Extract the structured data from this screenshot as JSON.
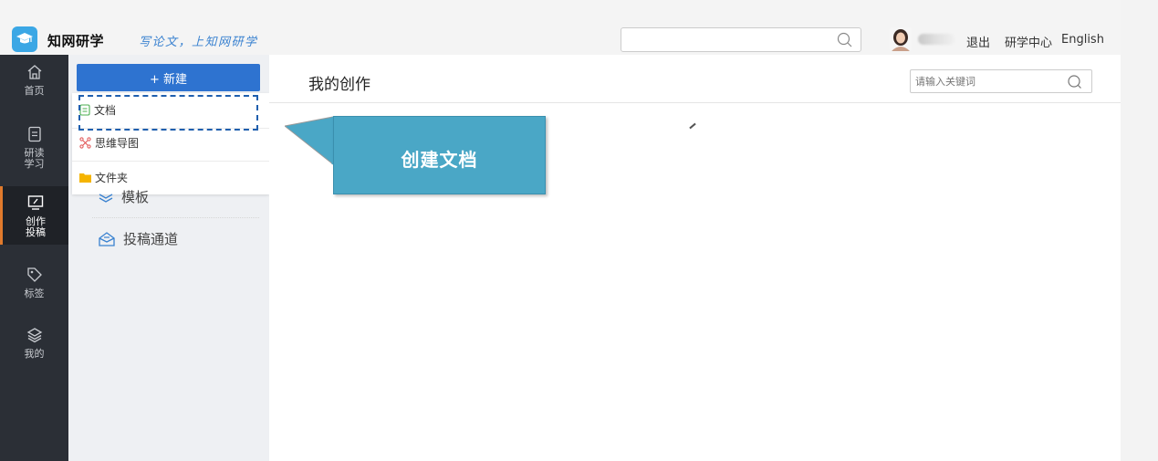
{
  "header": {
    "brand": "知网研学",
    "slogan": "写论文，上知网研学",
    "search_placeholder": "",
    "logout": "退出",
    "research_center": "研学中心",
    "english": "English"
  },
  "rail": {
    "items": [
      {
        "label": "首页",
        "icon": "home-icon"
      },
      {
        "label": "研读学习",
        "icon": "document-icon"
      },
      {
        "label": "创作投稿",
        "icon": "monitor-edit-icon",
        "active": true
      },
      {
        "label": "标签",
        "icon": "tag-icon"
      },
      {
        "label": "我的",
        "icon": "layers-icon"
      }
    ]
  },
  "sidebar": {
    "new_button": "+ 新建",
    "new_menu": [
      {
        "label": "文档",
        "icon": "document-icon",
        "icon_color": "#4caf50"
      },
      {
        "label": "思维导图",
        "icon": "mindmap-icon",
        "icon_color": "#e05050"
      },
      {
        "label": "文件夹",
        "icon": "folder-icon",
        "icon_color": "#f5b400"
      }
    ],
    "links": [
      {
        "label": "模板",
        "icon": "stack-icon"
      },
      {
        "label": "投稿通道",
        "icon": "mail-send-icon"
      }
    ]
  },
  "main": {
    "title": "我的创作",
    "keyword_placeholder": "请输入关键词"
  },
  "callout": {
    "text": "创建文档"
  },
  "colors": {
    "primary": "#2e73d0",
    "rail_bg": "#2b2f36",
    "rail_active_accent": "#e07a2c",
    "callout_bg": "#4aa7c6"
  }
}
